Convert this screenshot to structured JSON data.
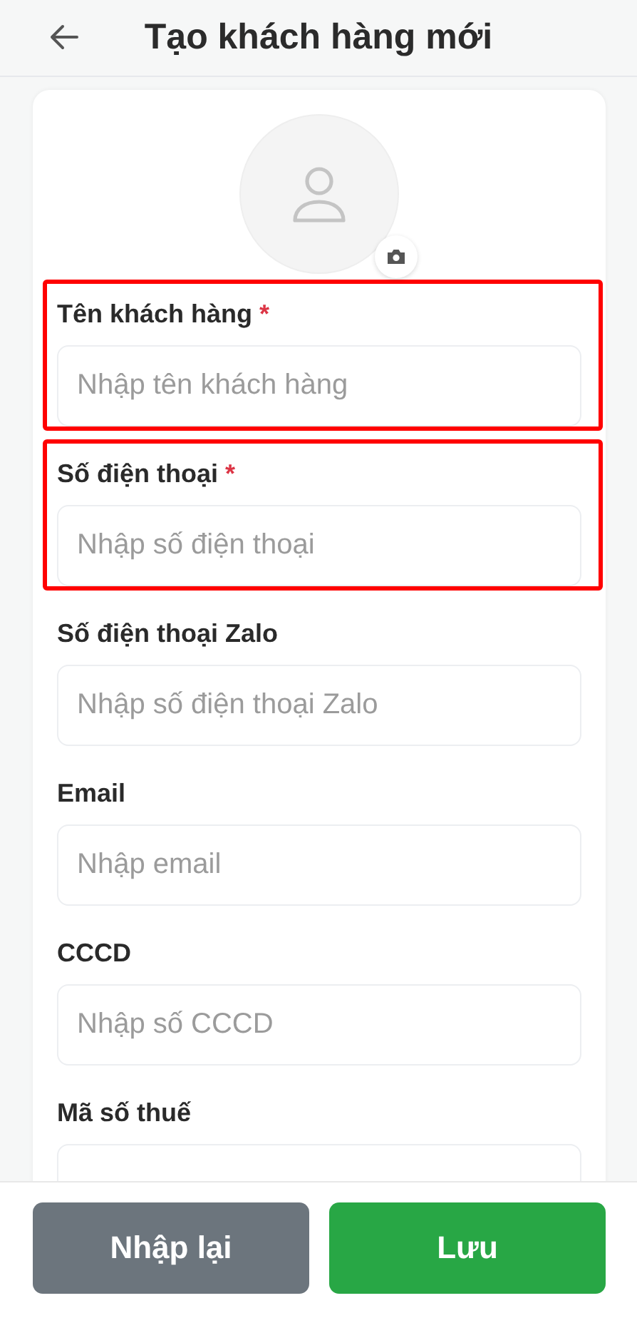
{
  "header": {
    "title": "Tạo khách hàng mới"
  },
  "fields": [
    {
      "label": "Tên khách hàng",
      "required_mark": "*",
      "placeholder": "Nhập tên khách hàng",
      "highlighted": true
    },
    {
      "label": "Số điện thoại",
      "required_mark": "*",
      "placeholder": "Nhập số điện thoại",
      "highlighted": true
    },
    {
      "label": "Số điện thoại Zalo",
      "placeholder": "Nhập số điện thoại Zalo",
      "highlighted": false
    },
    {
      "label": "Email",
      "placeholder": "Nhập email",
      "highlighted": false
    },
    {
      "label": "CCCD",
      "placeholder": "Nhập số CCCD",
      "highlighted": false
    },
    {
      "label": "Mã số thuế",
      "highlighted": false
    }
  ],
  "buttons": [
    {
      "label": "Nhập lại",
      "kind": "secondary"
    },
    {
      "label": "Lưu",
      "kind": "primary"
    }
  ]
}
